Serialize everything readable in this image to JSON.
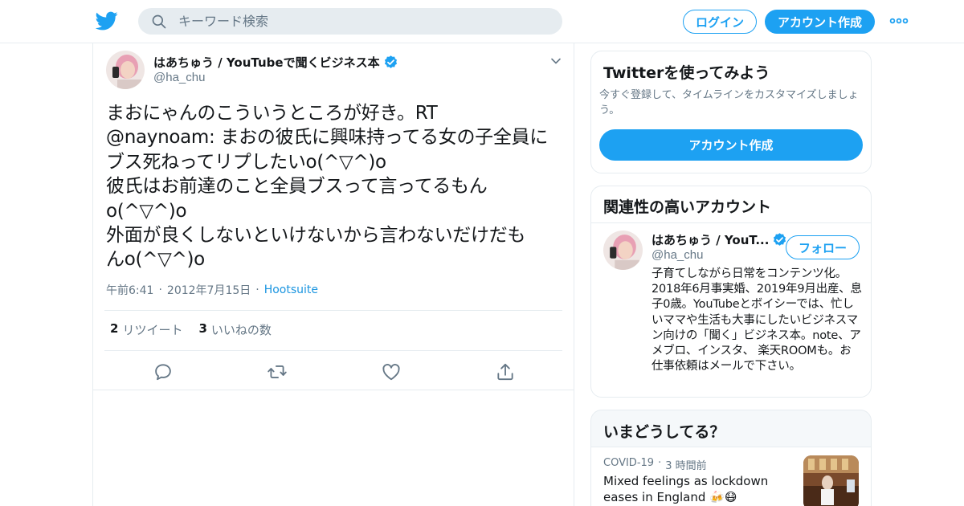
{
  "header": {
    "search_placeholder": "キーワード検索",
    "login_label": "ログイン",
    "signup_label": "アカウント作成"
  },
  "tweet": {
    "author_name": "はあちゅう / YouTubeで聞くビジネス本",
    "author_handle": "@ha_chu",
    "text": "まおにゃんのこういうところが好き。RT\n@naynoam: まおの彼氏に興味持ってる女の子全員に\nブス死ねってリプしたいo(^▽^)o\n彼氏はお前達のこと全員ブスって言ってるもん\no(^▽^)o\n外面が良くしないといけないから言わないだけだも\nんo(^▽^)o",
    "time": "午前6:41",
    "date": "2012年7月15日",
    "source": "Hootsuite",
    "retweet_count": "2",
    "retweet_label": "リツイート",
    "like_count": "3",
    "like_label": "いいねの数"
  },
  "signup_card": {
    "title": "Twitterを使ってみよう",
    "description": "今すぐ登録して、タイムラインをカスタマイズしましょう。",
    "button_label": "アカウント作成"
  },
  "related_card": {
    "title": "関連性の高いアカウント",
    "account_name": "はあちゅう / YouT...",
    "account_handle": "@ha_chu",
    "follow_label": "フォロー",
    "bio": "子育てしながら日常をコンテンツ化。2018年6月事実婚、2019年9月出産、息子0歳。YouTubeとボイシーでは、忙しいママや生活も大事にしたいビジネスマン向けの「聞く」ビジネス本。note、アメブロ、インスタ、 楽天ROOMも。お仕事依頼はメールで下さい。"
  },
  "trends_card": {
    "title": "いまどうしてる？",
    "category": "COVID-19",
    "time_ago": "3 時間前",
    "headline": "Mixed feelings as lockdown eases in England 🍻😷"
  },
  "colors": {
    "accent": "#1da1f2",
    "secondary_text": "#657786",
    "border": "#e6ecf0",
    "verified": "#1da1f2"
  },
  "icons": [
    "twitter-bird-icon",
    "search-icon",
    "more-icon",
    "verified-icon",
    "chevron-down-icon",
    "reply-icon",
    "retweet-icon",
    "like-icon",
    "share-icon"
  ]
}
